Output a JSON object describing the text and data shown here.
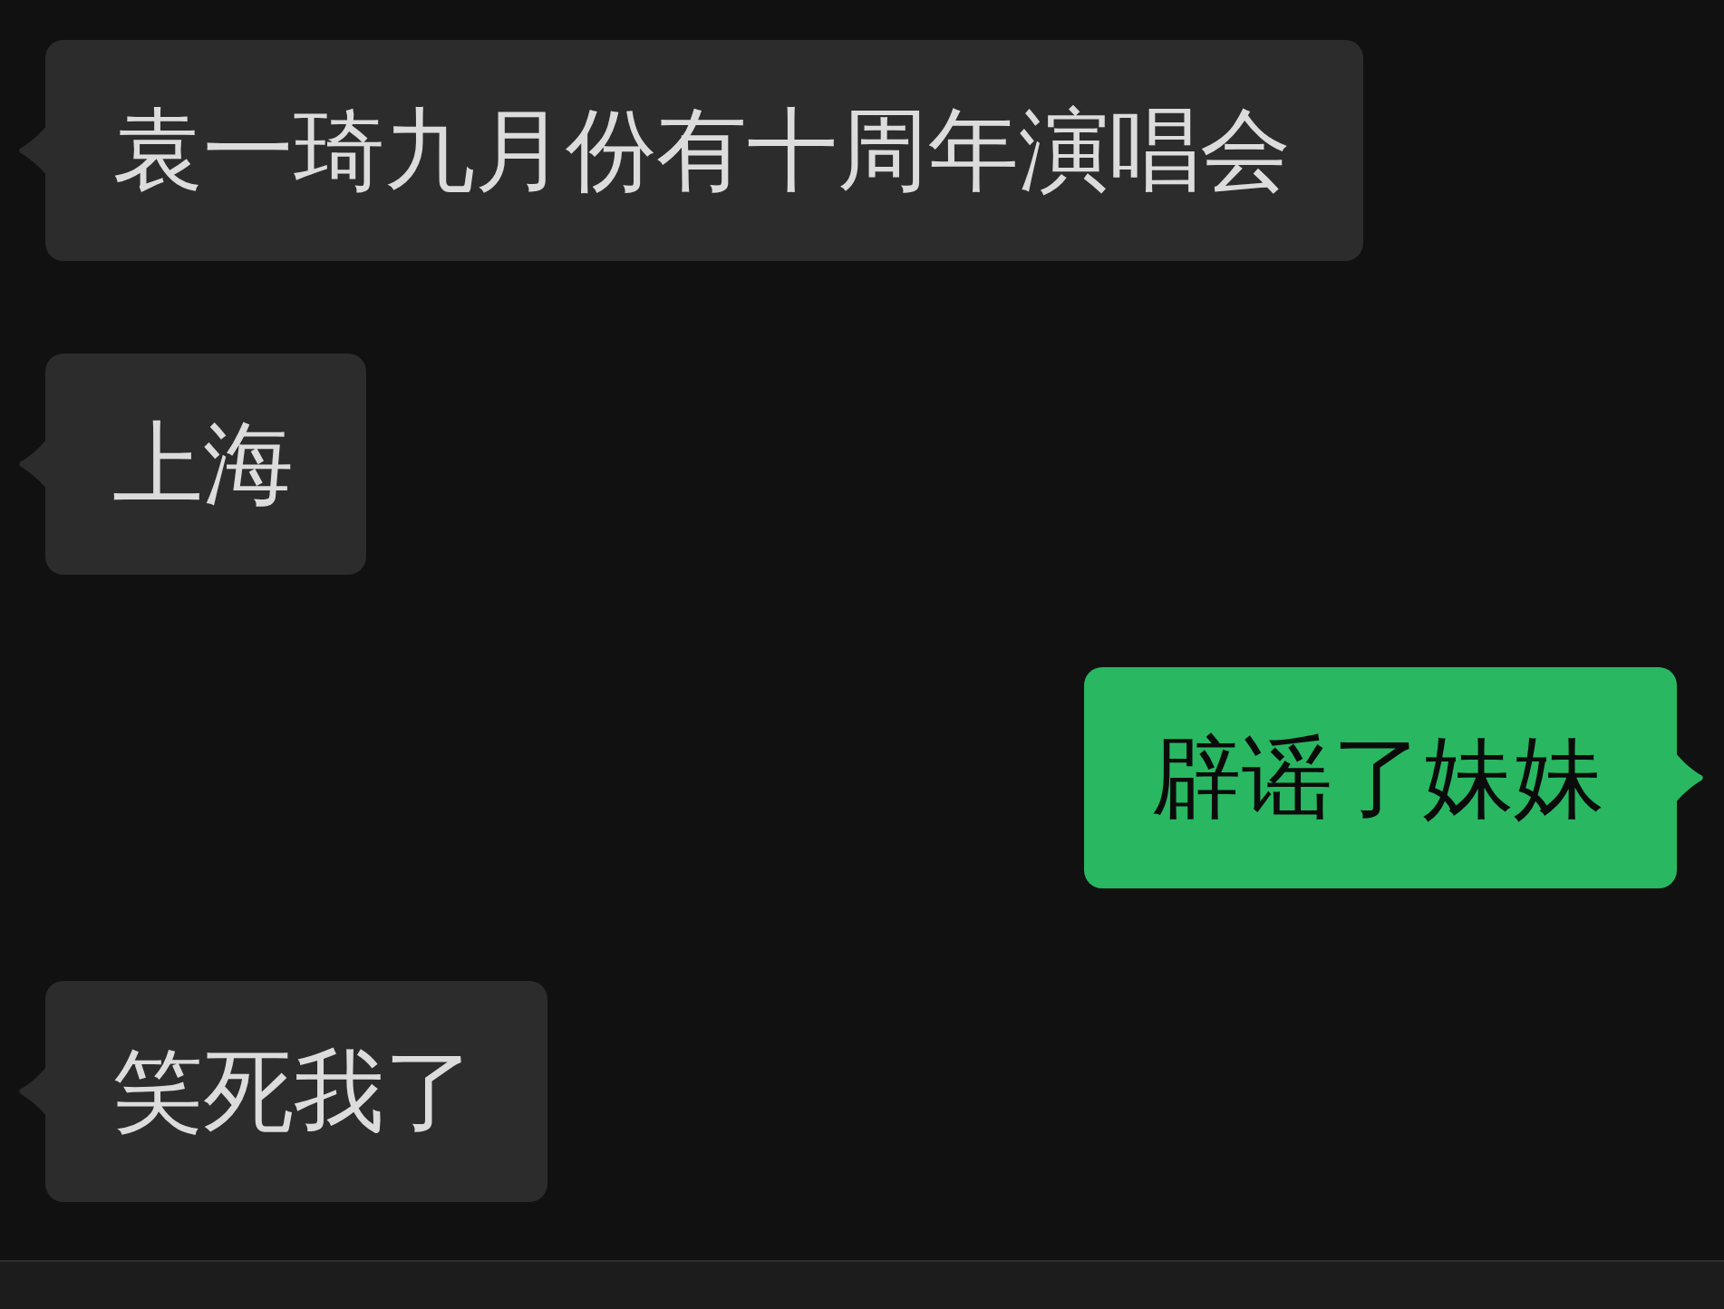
{
  "messages": [
    {
      "kind": "incoming",
      "text": "袁一琦九月份有十周年演唱会"
    },
    {
      "kind": "incoming",
      "text": "上海"
    },
    {
      "kind": "outgoing",
      "text": "辟谣了妹妹"
    },
    {
      "kind": "incoming",
      "text": "笑死我了"
    }
  ]
}
